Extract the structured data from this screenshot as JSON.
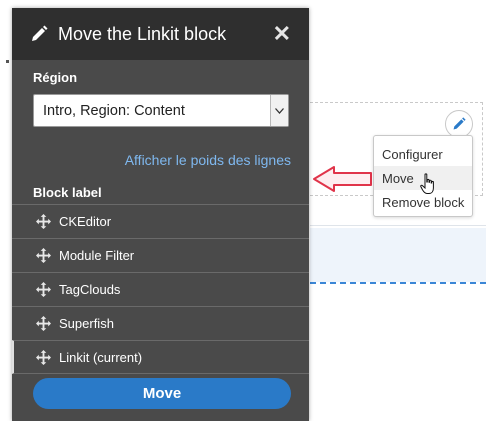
{
  "dialog": {
    "title": "Move the Linkit block",
    "close_glyph": "✕"
  },
  "region": {
    "label": "Région",
    "value": "Intro, Region: Content"
  },
  "weights_link": "Afficher le poids des lignes",
  "block_label_header": "Block label",
  "blocks": [
    {
      "label": "CKEditor"
    },
    {
      "label": "Module Filter"
    },
    {
      "label": "TagClouds"
    },
    {
      "label": "Superfish"
    },
    {
      "label": "Linkit (current)"
    }
  ],
  "move_button": "Move",
  "context_menu": {
    "items": [
      {
        "label": "Configurer"
      },
      {
        "label": "Move"
      },
      {
        "label": "Remove block"
      }
    ]
  },
  "colors": {
    "dialog_bg": "#4a4a4a",
    "header_bg": "#2f2f2f",
    "link": "#7fb8ef",
    "button": "#2a7ac8",
    "arrow": "#e0344a"
  },
  "icons": {
    "header": "pencil-icon",
    "close": "close-icon",
    "select": "chevron-down-icon",
    "row": "move-arrows-icon",
    "context": "pencil-icon",
    "cursor": "hand-pointer-icon"
  }
}
